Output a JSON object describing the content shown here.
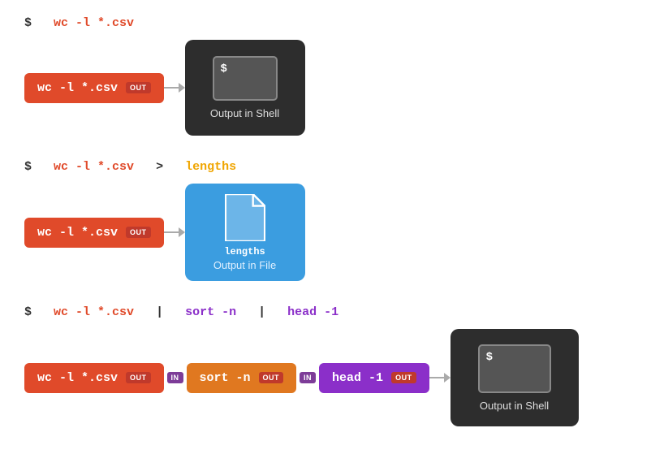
{
  "section1": {
    "cmd_line": {
      "dollar": "$",
      "cmd": "wc -l *.csv"
    },
    "pill": {
      "text": "wc -l *.csv",
      "badge": "OUT"
    },
    "output": {
      "dollar": "$",
      "label": "Output in Shell"
    }
  },
  "section2": {
    "cmd_line": {
      "dollar": "$",
      "cmd": "wc -l *.csv",
      "redirect": ">",
      "filename": "lengths"
    },
    "pill": {
      "text": "wc -l *.csv",
      "badge": "OUT"
    },
    "output": {
      "filename": "lengths",
      "label": "Output in File"
    }
  },
  "section3": {
    "cmd_line": {
      "dollar": "$",
      "cmd1": "wc -l *.csv",
      "pipe1": "|",
      "cmd2": "sort -n",
      "pipe2": "|",
      "cmd3": "head -1"
    },
    "pill1": {
      "text": "wc -l *.csv",
      "badge_out": "OUT"
    },
    "badge_in1": "IN",
    "pill2": {
      "text": "sort -n",
      "badge_out": "OUT"
    },
    "badge_in2": "IN",
    "pill3": {
      "text": "head -1",
      "badge_out": "OUT"
    },
    "output": {
      "dollar": "$",
      "label": "Output in Shell"
    }
  },
  "arrows": {
    "right": "→"
  }
}
